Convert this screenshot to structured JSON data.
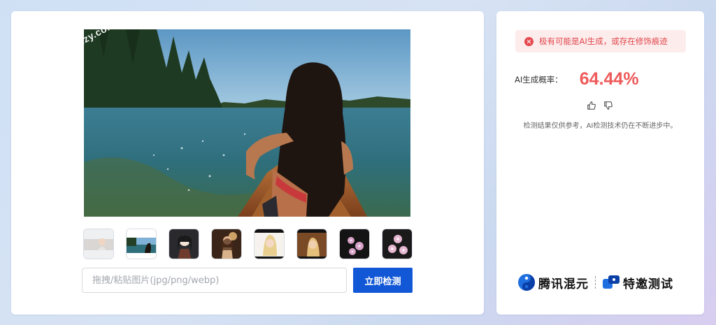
{
  "left": {
    "main_image": {
      "watermark": "izy.com",
      "alt": "Woman in a canoe on a lake"
    },
    "thumbnails": [
      {
        "name": "thumb-portrait-woman"
      },
      {
        "name": "thumb-lake-canoe",
        "selected": true
      },
      {
        "name": "thumb-anime-girl"
      },
      {
        "name": "thumb-woman-warm-light"
      },
      {
        "name": "thumb-blonde-portrait"
      },
      {
        "name": "thumb-blonde-warm"
      },
      {
        "name": "thumb-pink-flowers"
      },
      {
        "name": "thumb-pink-flowers-2"
      }
    ],
    "upload": {
      "placeholder": "拖拽/粘贴图片(jpg/png/webp)",
      "button_label": "立即检测"
    }
  },
  "right": {
    "alert_text": "极有可能是AI生成，或存在修饰痕迹",
    "probability_label": "AI生成概率：",
    "probability_value": "64.44%",
    "disclaimer": "检测结果仅供参考，AI检测技术仍在不断进步中。",
    "brand": {
      "name": "腾讯混元",
      "tag": "特邀测试"
    }
  },
  "colors": {
    "accent": "#1157d6",
    "alert_red": "#e0484c",
    "probability_red": "#ef5a5a",
    "alert_bg": "#fdecec"
  }
}
